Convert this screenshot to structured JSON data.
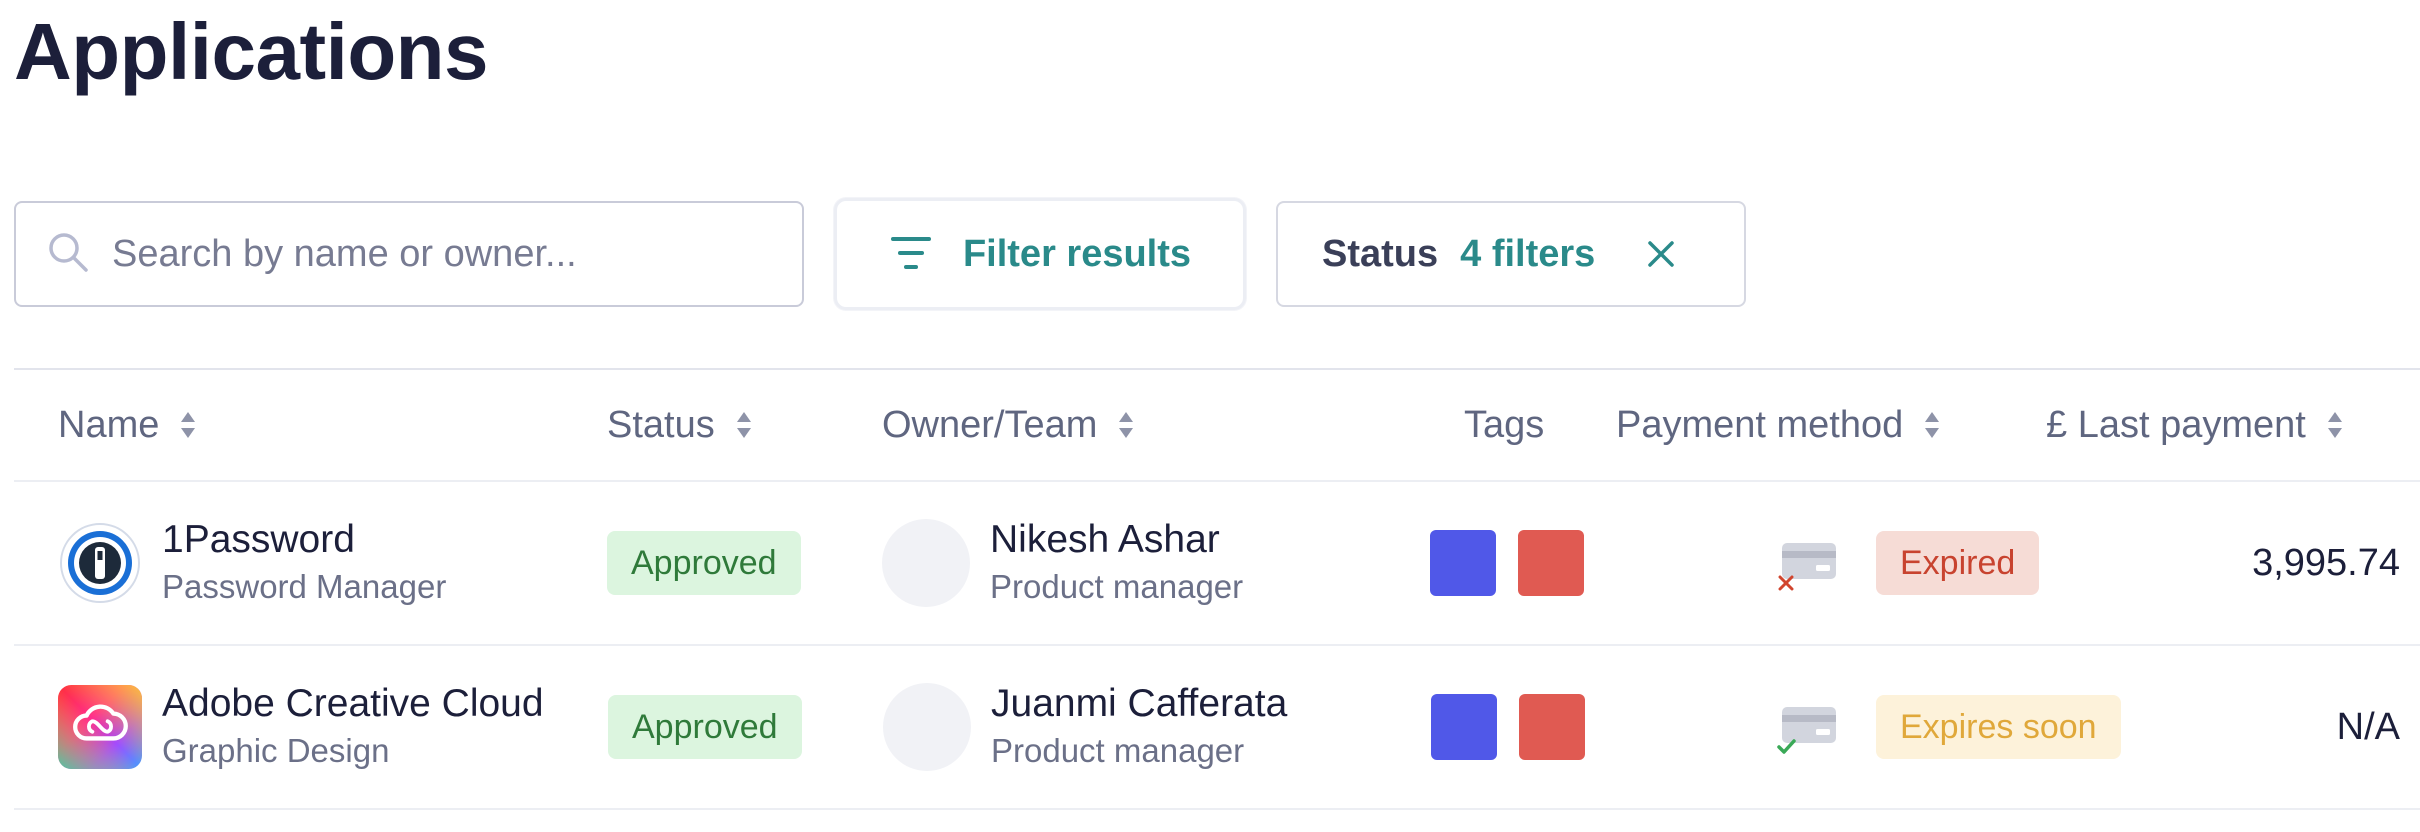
{
  "page": {
    "title": "Applications"
  },
  "search": {
    "placeholder": "Search by name or owner..."
  },
  "filter_button": {
    "label": "Filter results"
  },
  "status_filter": {
    "label": "Status",
    "count_label": "4 filters"
  },
  "table": {
    "columns": [
      {
        "key": "name",
        "label": "Name",
        "sortable": true
      },
      {
        "key": "status",
        "label": "Status",
        "sortable": true
      },
      {
        "key": "owner",
        "label": "Owner/Team",
        "sortable": true
      },
      {
        "key": "tags",
        "label": "Tags",
        "sortable": false
      },
      {
        "key": "payment_method",
        "label": "Payment method",
        "sortable": true
      },
      {
        "key": "last_payment",
        "label": "£ Last payment",
        "sortable": true
      }
    ],
    "rows": [
      {
        "app_name": "1Password",
        "app_category": "Password Manager",
        "app_icon": "1password-logo",
        "status": "Approved",
        "owner_name": "Nikesh Ashar",
        "owner_role": "Product manager",
        "tags": [
          "#5058e8",
          "#e05a52"
        ],
        "card_state_icon": "card-error-icon",
        "payment_status": "Expired",
        "payment_status_color": "#c8432f",
        "payment_status_bg": "#f6dcd6",
        "last_payment": "3,995.74"
      },
      {
        "app_name": "Adobe Creative Cloud",
        "app_category": "Graphic Design",
        "app_icon": "adobe-creative-cloud-logo",
        "status": "Approved",
        "owner_name": "Juanmi Cafferata",
        "owner_role": "Product manager",
        "tags": [
          "#5058e8",
          "#e05a52"
        ],
        "card_state_icon": "card-ok-icon",
        "payment_status": "Expires soon",
        "payment_status_color": "#e0a83a",
        "payment_status_bg": "#fdf2da",
        "last_payment": "N/A"
      }
    ]
  },
  "colors": {
    "accent": "#2a8a8a",
    "title": "#1c1f3a",
    "approved_bg": "#dcf5df",
    "approved_text": "#2f7a3a"
  }
}
